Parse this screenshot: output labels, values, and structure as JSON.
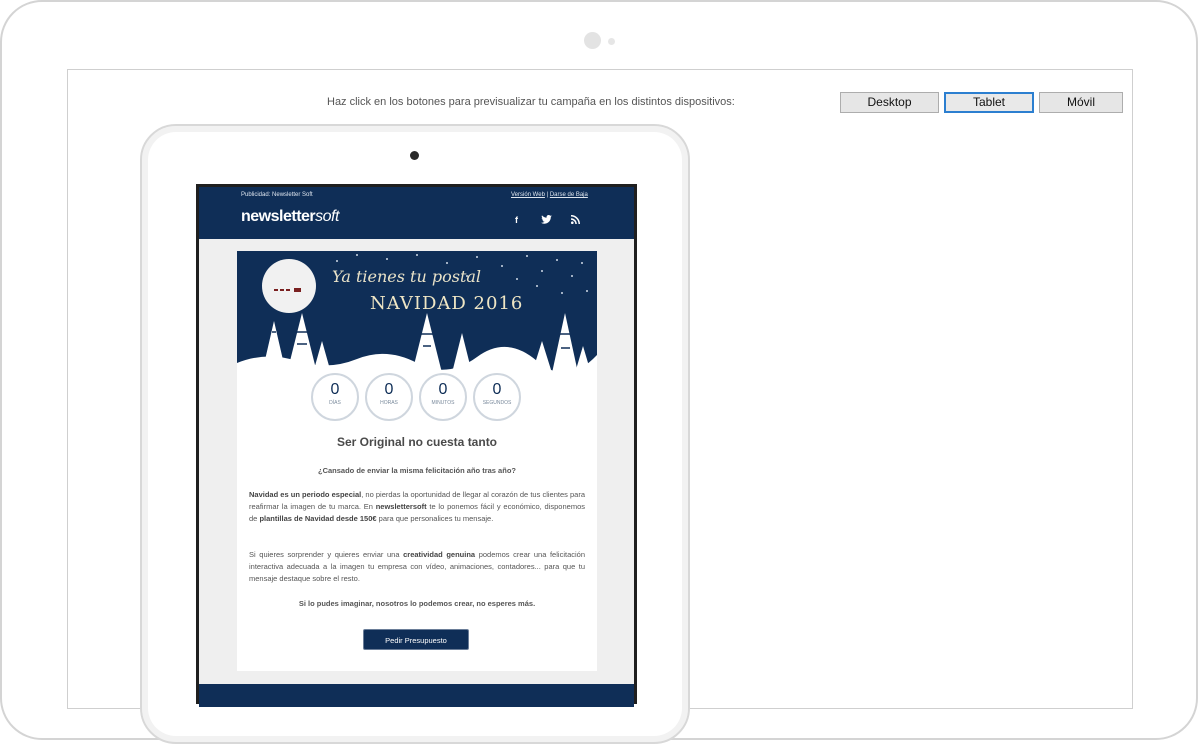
{
  "toolbar": {
    "instruction": "Haz click en los botones para previsualizar tu campaña en los distintos dispositivos:",
    "buttons": [
      "Desktop",
      "Tablet",
      "Móvil"
    ],
    "active": "Tablet"
  },
  "newsletter": {
    "publicidad": "Publicidad: Newsletter Soft",
    "version_web": "Versión Web",
    "separator": "|",
    "darse_de_baja": "Darse de Baja",
    "logo_main": "newsletter",
    "logo_accent": "soft",
    "social": {
      "facebook": "f",
      "twitter": "t",
      "rss": "rss"
    },
    "banner": {
      "subtitle": "Ya tienes tu postal",
      "title": "NAVIDAD 2016"
    },
    "countdown": [
      {
        "value": "0",
        "label": "DÍAS"
      },
      {
        "value": "0",
        "label": "HORAS"
      },
      {
        "value": "0",
        "label": "MINUTOS"
      },
      {
        "value": "0",
        "label": "SEGUNDOS"
      }
    ],
    "content_title": "Ser Original no cuesta tanto",
    "question": "¿Cansado de enviar la misma felicitación año tras año?",
    "p1_bold": "Navidad es un periodo especial",
    "p1_a": ", no pierdas la oportunidad de llegar al corazón de tus clientes para reafirmar la imagen de tu marca. En ",
    "p1_brand": "newslettersoft",
    "p1_b": " te lo ponemos fácil y económico, disponemos de ",
    "p1_bold2": "plantillas de Navidad desde 150€",
    "p1_c": " para que personalices tu mensaje.",
    "p2_a": "Si quieres sorprender y quieres enviar una ",
    "p2_bold": "creatividad genuina",
    "p2_b": " podemos crear una felicitación interactiva adecuada a la imagen tu empresa con vídeo, animaciones, contadores... para que tu mensaje destaque sobre el resto.",
    "closing": "Si lo pudes imaginar, nosotros lo podemos crear, no esperes más.",
    "cta": "Pedir Presupuesto"
  },
  "colors": {
    "navy": "#0f2e57",
    "active_border": "#2c7fd0"
  }
}
